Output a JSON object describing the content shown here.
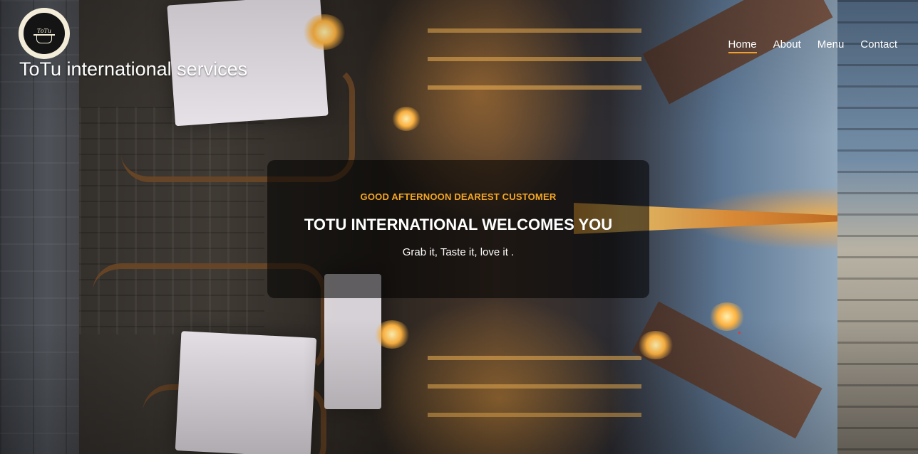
{
  "header": {
    "logo": {
      "text": "ToTu",
      "icon": "cooking-pot-icon"
    },
    "site_name": "ToTu international services"
  },
  "nav": {
    "items": [
      {
        "label": "Home",
        "active": true
      },
      {
        "label": "About",
        "active": false
      },
      {
        "label": "Menu",
        "active": false
      },
      {
        "label": "Contact",
        "active": false
      }
    ]
  },
  "hero": {
    "kicker": "GOOD AFTERNOON DEAREST CUSTOMER",
    "title": "TOTU INTERNATIONAL WELCOMES YOU",
    "tagline": "Grab it, Taste it, love it ."
  },
  "colors": {
    "accent": "#f5a623",
    "text": "#ffffff",
    "card_bg": "rgba(0,0,0,0.55)"
  }
}
